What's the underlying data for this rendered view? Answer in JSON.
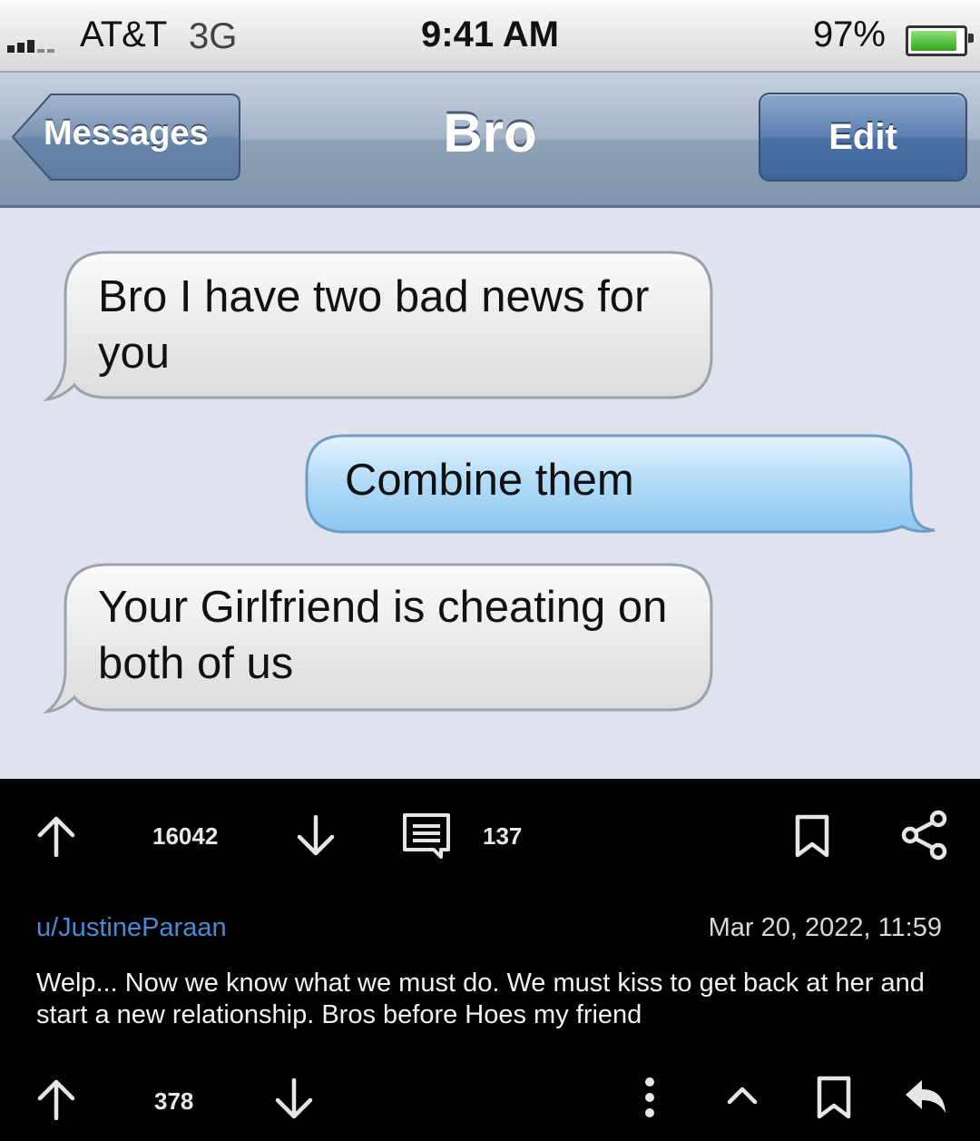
{
  "status_bar": {
    "carrier": "AT&T",
    "network": "3G",
    "time": "9:41 AM",
    "battery_percent": "97%"
  },
  "nav_bar": {
    "back_label": "Messages",
    "title": "Bro",
    "edit_label": "Edit"
  },
  "messages": [
    {
      "side": "received",
      "text": "Bro I have two bad news for you"
    },
    {
      "side": "sent",
      "text": "Combine them"
    },
    {
      "side": "received",
      "text": "Your Girlfriend is cheating on both of us"
    }
  ],
  "post_actions": {
    "score": "16042",
    "comment_count": "137"
  },
  "comment": {
    "author": "u/JustineParaan",
    "date": "Mar 20, 2022, 11:59",
    "body": "Welp... Now we know what we must do. We must kiss to get back at her and start a new relationship. Bros before Hoes my friend",
    "score": "378"
  },
  "colors": {
    "sent_bubble": "#a9d3f5",
    "received_bubble": "#e8e8e8",
    "username": "#4a8bd6",
    "app_background": "#000000"
  }
}
